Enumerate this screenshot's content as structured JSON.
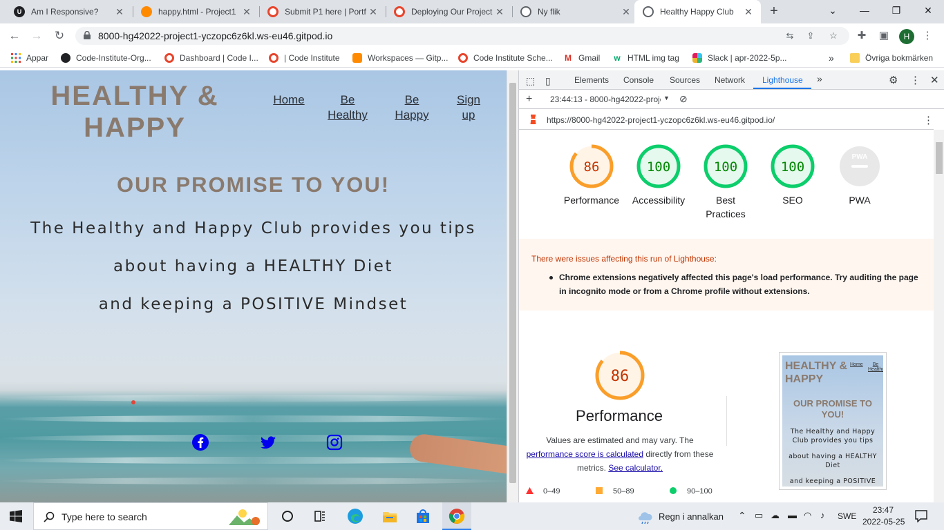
{
  "tabs": [
    {
      "title": "Am I Responsive?",
      "icon": "am-i-responsive-icon",
      "color": "#202124",
      "glyph": "U"
    },
    {
      "title": "happy.html - Project1",
      "icon": "gitpod-icon",
      "color": "#ff8a00",
      "glyph": ""
    },
    {
      "title": "Submit P1 here | Portf",
      "icon": "code-institute-icon",
      "color": "#e8452c",
      "glyph": ""
    },
    {
      "title": "Deploying Our Project",
      "icon": "code-institute-icon",
      "color": "#e8452c",
      "glyph": ""
    },
    {
      "title": "Ny flik",
      "icon": "globe-icon",
      "color": "#5f6368",
      "glyph": ""
    },
    {
      "title": "Healthy Happy Club",
      "icon": "globe-icon",
      "color": "#5f6368",
      "glyph": ""
    }
  ],
  "address": {
    "url": "8000-hg42022-project1-yczopc6z6kl.ws-eu46.gitpod.io"
  },
  "bookmarks": [
    {
      "label": "Appar",
      "icon": "apps-grid-icon",
      "color": "#4285f4"
    },
    {
      "label": "Code-Institute-Org...",
      "icon": "github-icon",
      "color": "#202124"
    },
    {
      "label": "Dashboard | Code I...",
      "icon": "code-institute-icon",
      "color": "#e8452c"
    },
    {
      "label": "| Code Institute",
      "icon": "code-institute-icon",
      "color": "#e8452c"
    },
    {
      "label": "Workspaces — Gitp...",
      "icon": "gitpod-icon",
      "color": "#ff8a00"
    },
    {
      "label": "Code Institute Sche...",
      "icon": "code-institute-icon",
      "color": "#e8452c"
    },
    {
      "label": "Gmail",
      "icon": "gmail-icon",
      "color": "#d93025"
    },
    {
      "label": "HTML img tag",
      "icon": "w3schools-icon",
      "color": "#04aa6d"
    },
    {
      "label": "Slack | apr-2022-5p...",
      "icon": "slack-icon",
      "color": "#611f69"
    }
  ],
  "bookmarks_more": "»",
  "other_bookmarks": "Övriga bokmärken",
  "site": {
    "logo_line1": "HEALTHY &",
    "logo_line2": "HAPPY",
    "nav": [
      "Home",
      "Be Healthy",
      "Be Happy",
      "Sign up"
    ],
    "promise": "OUR PROMISE TO YOU!",
    "lead1": "The Healthy and Happy Club provides you tips",
    "lead2": "about having a HEALTHY Diet",
    "lead3": "and keeping a POSITIVE Mindset",
    "social": [
      "facebook-icon",
      "twitter-icon",
      "instagram-icon"
    ],
    "social_color": "#0000ee"
  },
  "devtools": {
    "tabs": [
      "Elements",
      "Console",
      "Sources",
      "Network",
      "Lighthouse"
    ],
    "more": "»",
    "report": "23:44:13 - 8000-hg42022-proje",
    "report_url": "https://8000-hg42022-project1-yczopc6z6kl.ws-eu46.gitpod.io/",
    "scores": [
      {
        "label": "Performance",
        "value": "86",
        "ratio": 0.86,
        "color": "#fa9e2a",
        "bg": "#fff4e6",
        "text": "#c33300"
      },
      {
        "label": "Accessibility",
        "value": "100",
        "ratio": 1,
        "color": "#0cce6b",
        "bg": "#e6f9ee",
        "text": "#008800"
      },
      {
        "label": "Best Practices",
        "value": "100",
        "ratio": 1,
        "color": "#0cce6b",
        "bg": "#e6f9ee",
        "text": "#008800"
      },
      {
        "label": "SEO",
        "value": "100",
        "ratio": 1,
        "color": "#0cce6b",
        "bg": "#e6f9ee",
        "text": "#008800"
      },
      {
        "label": "PWA",
        "value": "PWA",
        "ratio": 0,
        "color": "#e0e0e0",
        "bg": "#e8e8e8",
        "text": "#ffffff"
      }
    ],
    "warning_title": "There were issues affecting this run of Lighthouse:",
    "warning_item": "Chrome extensions negatively affected this page's load performance. Try auditing the page in incognito mode or from a Chrome profile without extensions.",
    "perf_value": "86",
    "perf_title": "Performance",
    "perf_note_1": "Values are estimated and may vary. The",
    "perf_link1": "performance score is calculated",
    "perf_note_2": "directly from these",
    "perf_note_3": "metrics.",
    "perf_link2": "See calculator.",
    "legend": [
      {
        "range": "0–49",
        "color": "#ff3333",
        "shape": "triangle"
      },
      {
        "range": "50–89",
        "color": "#ffaa33",
        "shape": "square"
      },
      {
        "range": "90–100",
        "color": "#0cce6b",
        "shape": "circle"
      }
    ],
    "thumb": {
      "logo": "HEALTHY & HAPPY",
      "nav1": "Home",
      "nav2": "Be Healthy",
      "promise": "OUR PROMISE TO YOU!",
      "lead1": "The Healthy and Happy Club provides you tips",
      "lead2": "about having a HEALTHY Diet",
      "lead3": "and keeping a POSITIVE"
    }
  },
  "taskbar": {
    "search_placeholder": "Type here to search",
    "weather": "Regn i annalkan",
    "lang": "SWE",
    "time": "23:47",
    "date": "2022-05-25"
  }
}
